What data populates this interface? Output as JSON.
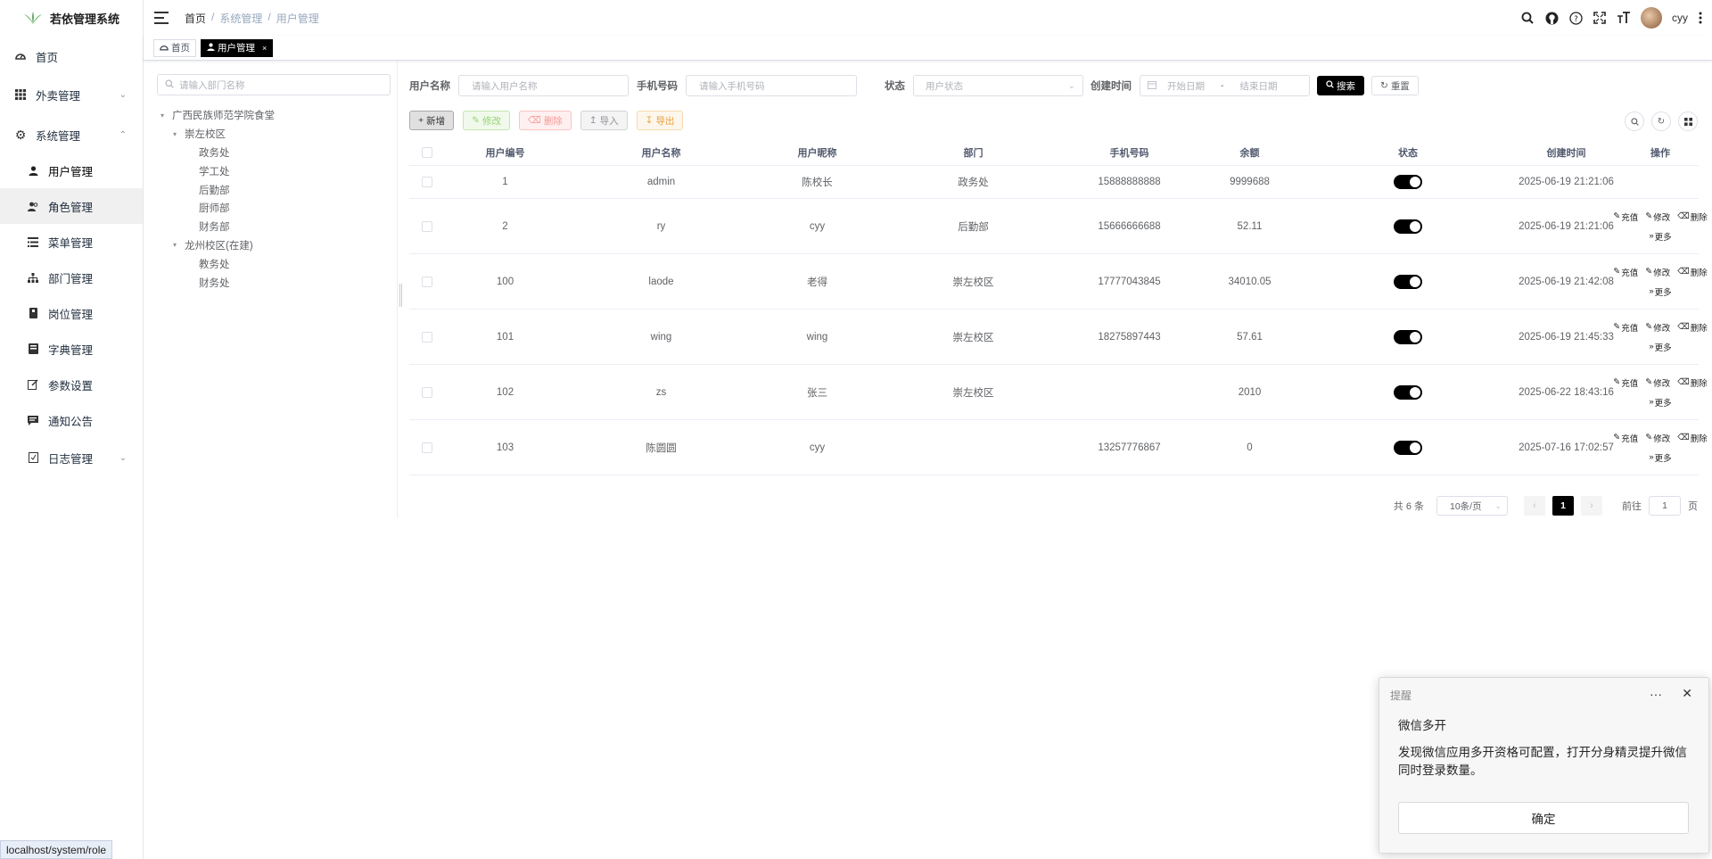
{
  "app": {
    "title": "若依管理系统"
  },
  "sidebar": {
    "items": [
      {
        "label": "首页",
        "icon": "dashboard-icon"
      },
      {
        "label": "外卖管理",
        "icon": "grid-icon"
      },
      {
        "label": "系统管理",
        "icon": "gear-icon"
      },
      {
        "label": "用户管理",
        "icon": "user-icon"
      },
      {
        "label": "角色管理",
        "icon": "peoples-icon"
      },
      {
        "label": "菜单管理",
        "icon": "tree-table-icon"
      },
      {
        "label": "部门管理",
        "icon": "tree-icon"
      },
      {
        "label": "岗位管理",
        "icon": "post-icon"
      },
      {
        "label": "字典管理",
        "icon": "dict-icon"
      },
      {
        "label": "参数设置",
        "icon": "edit-icon"
      },
      {
        "label": "通知公告",
        "icon": "message-icon"
      },
      {
        "label": "日志管理",
        "icon": "log-icon"
      }
    ]
  },
  "breadcrumb": [
    "首页",
    "系统管理",
    "用户管理"
  ],
  "navbar": {
    "username": "cyy"
  },
  "tags": [
    {
      "label": "首页"
    },
    {
      "label": "用户管理"
    }
  ],
  "dept": {
    "search_placeholder": "请输入部门名称",
    "tree": [
      {
        "label": "广西民族师范学院食堂"
      },
      {
        "label": "崇左校区"
      },
      {
        "label": "政务处"
      },
      {
        "label": "学工处"
      },
      {
        "label": "后勤部"
      },
      {
        "label": "厨师部"
      },
      {
        "label": "财务部"
      },
      {
        "label": "龙州校区(在建)"
      },
      {
        "label": "教务处"
      },
      {
        "label": "财务处"
      }
    ]
  },
  "search": {
    "username_label": "用户名称",
    "username_placeholder": "请输入用户名称",
    "phone_label": "手机号码",
    "phone_placeholder": "请输入手机号码",
    "status_label": "状态",
    "status_placeholder": "用户状态",
    "time_label": "创建时间",
    "start_placeholder": "开始日期",
    "range_sep": "-",
    "end_placeholder": "结束日期",
    "search_btn": "搜索",
    "reset_btn": "重置"
  },
  "toolbar": {
    "add": "新增",
    "edit": "修改",
    "delete": "删除",
    "import": "导入",
    "export": "导出"
  },
  "table": {
    "headers": [
      "用户编号",
      "用户名称",
      "用户昵称",
      "部门",
      "手机号码",
      "余额",
      "状态",
      "创建时间",
      "操作"
    ],
    "rows": [
      {
        "id": "1",
        "name": "admin",
        "nick": "陈校长",
        "dept": "政务处",
        "phone": "15888888888",
        "balance": "9999688",
        "status": true,
        "time": "2025-06-19 21:21:06",
        "ops": false
      },
      {
        "id": "2",
        "name": "ry",
        "nick": "cyy",
        "dept": "后勤部",
        "phone": "15666666688",
        "balance": "52.11",
        "status": true,
        "time": "2025-06-19 21:21:06",
        "ops": true
      },
      {
        "id": "100",
        "name": "laode",
        "nick": "老得",
        "dept": "崇左校区",
        "phone": "17777043845",
        "balance": "34010.05",
        "status": true,
        "time": "2025-06-19 21:42:08",
        "ops": true
      },
      {
        "id": "101",
        "name": "wing",
        "nick": "wing",
        "dept": "崇左校区",
        "phone": "18275897443",
        "balance": "57.61",
        "status": true,
        "time": "2025-06-19 21:45:33",
        "ops": true
      },
      {
        "id": "102",
        "name": "zs",
        "nick": "张三",
        "dept": "崇左校区",
        "phone": "",
        "balance": "2010",
        "status": true,
        "time": "2025-06-22 18:43:16",
        "ops": true
      },
      {
        "id": "103",
        "name": "陈圆圆",
        "nick": "cyy",
        "dept": "",
        "phone": "13257776867",
        "balance": "0",
        "status": true,
        "time": "2025-07-16 17:02:57",
        "ops": true
      }
    ],
    "op_labels": {
      "recharge": "充值",
      "edit": "修改",
      "delete": "删除",
      "more": "更多"
    }
  },
  "pagination": {
    "total": "共 6 条",
    "page_size": "10条/页",
    "current": "1",
    "goto_label": "前往",
    "goto_value": "1",
    "page_unit": "页"
  },
  "notification": {
    "header": "提醒",
    "title": "微信多开",
    "body": "发现微信应用多开资格可配置，打开分身精灵提升微信同时登录数量。",
    "ok": "确定"
  },
  "status_url": "localhost/system/role",
  "colors": {
    "accent": "#000000",
    "switch_on": "#000000"
  }
}
